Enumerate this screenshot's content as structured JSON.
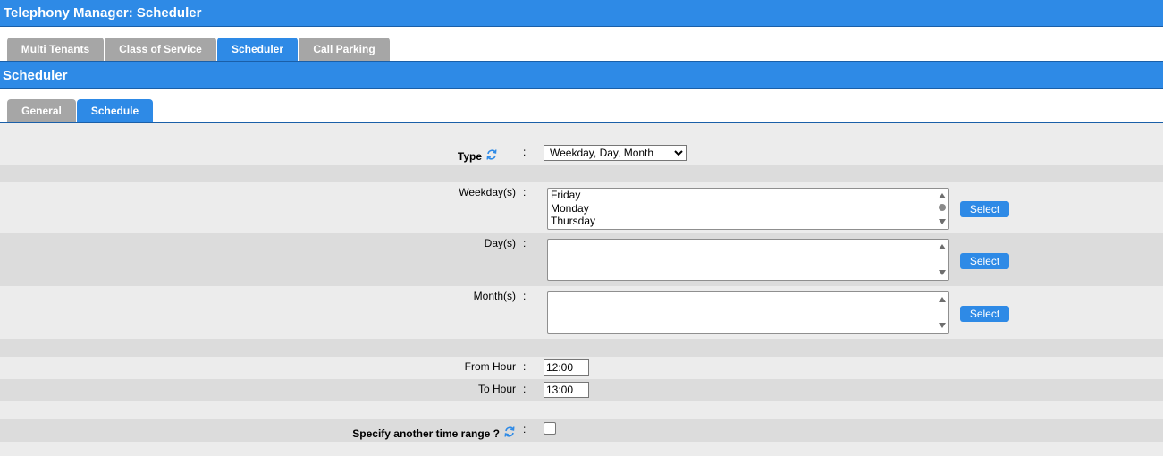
{
  "app": {
    "title": "Telephony Manager:  Scheduler"
  },
  "main_tabs": [
    {
      "label": "Multi Tenants",
      "active": false
    },
    {
      "label": "Class of Service",
      "active": false
    },
    {
      "label": "Scheduler",
      "active": true
    },
    {
      "label": "Call Parking",
      "active": false
    }
  ],
  "section": {
    "title": "Scheduler"
  },
  "sub_tabs": [
    {
      "label": "General",
      "active": false
    },
    {
      "label": "Schedule",
      "active": true
    }
  ],
  "form": {
    "colon": ":",
    "type": {
      "label": "Type",
      "value": "Weekday, Day, Month",
      "icon": "refresh-icon"
    },
    "weekdays": {
      "label": "Weekday(s)",
      "items": [
        "Friday",
        "Monday",
        "Thursday"
      ],
      "button": "Select"
    },
    "days": {
      "label": "Day(s)",
      "items": [],
      "button": "Select"
    },
    "months": {
      "label": "Month(s)",
      "items": [],
      "button": "Select"
    },
    "from_hour": {
      "label": "From Hour",
      "value": "12:00"
    },
    "to_hour": {
      "label": "To Hour",
      "value": "13:00"
    },
    "another_range": {
      "label": "Specify another time range ?",
      "checked": false,
      "icon": "refresh-icon"
    }
  },
  "colors": {
    "accent": "#2e8ae6",
    "tab_inactive": "#a6a6a6",
    "row_light": "#ececec",
    "row_dark": "#dcdcdc"
  }
}
